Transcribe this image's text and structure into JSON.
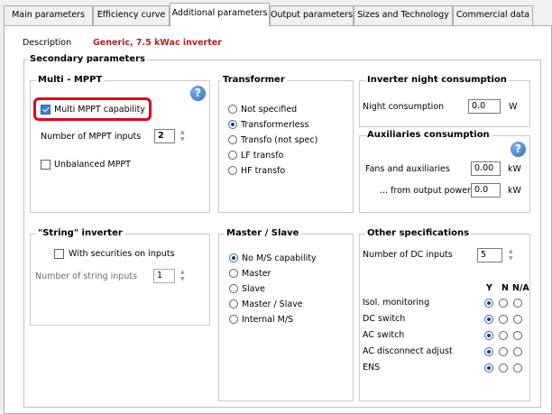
{
  "tabs": [
    {
      "label": "Main parameters"
    },
    {
      "label": "Efficiency curve"
    },
    {
      "label": "Additional parameters"
    },
    {
      "label": "Output parameters"
    },
    {
      "label": "Sizes and Technology"
    },
    {
      "label": "Commercial data"
    }
  ],
  "active_tab": "Additional parameters",
  "description": {
    "label": "Description",
    "value": "Generic,  7.5 kWac inverter"
  },
  "secondary_title": "Secondary parameters",
  "multi_mppt": {
    "title": "Multi - MPPT",
    "capability_label": "Multi MPPT capability",
    "capability_checked": true,
    "inputs_label": "Number of MPPT inputs",
    "inputs_value": "2",
    "unbalanced_label": "Unbalanced MPPT",
    "unbalanced_checked": false
  },
  "transformer": {
    "title": "Transformer",
    "options": [
      "Not specified",
      "Transformerless",
      "Transfo (not spec)",
      "LF transfo",
      "HF transfo"
    ],
    "selected": "Transformerless"
  },
  "night": {
    "title": "Inverter night consumption",
    "label": "Night consumption",
    "value": "0.0",
    "unit": "W"
  },
  "aux": {
    "title": "Auxiliaries consumption",
    "fans_label": "Fans and auxiliaries",
    "fans_value": "0.00",
    "fans_unit": "kW",
    "from_label": "... from output power",
    "from_value": "0.0",
    "from_unit": "kW"
  },
  "string_inv": {
    "title": "\"String\" inverter",
    "securities_label": "With securities on inputs",
    "securities_checked": false,
    "count_label": "Number of string inputs",
    "count_value": "1"
  },
  "master_slave": {
    "title": "Master / Slave",
    "options": [
      "No M/S capability",
      "Master",
      "Slave",
      "Master / Slave",
      "Internal M/S"
    ],
    "selected": "No M/S capability"
  },
  "other": {
    "title": "Other specifications",
    "dc_inputs_label": "Number of DC inputs",
    "dc_inputs_value": "5",
    "col_y": "Y",
    "col_n": "N",
    "col_na": "N/A",
    "rows": [
      {
        "label": "Isol. monitoring",
        "value": "Y"
      },
      {
        "label": "DC switch",
        "value": "Y"
      },
      {
        "label": "AC switch",
        "value": "Y"
      },
      {
        "label": "AC disconnect adjust",
        "value": "Y"
      },
      {
        "label": "ENS",
        "value": "Y"
      }
    ]
  },
  "colors": {
    "accent_red": "#e3001b",
    "description_value": "#b22222",
    "help_blue": "#2e6cc1"
  }
}
